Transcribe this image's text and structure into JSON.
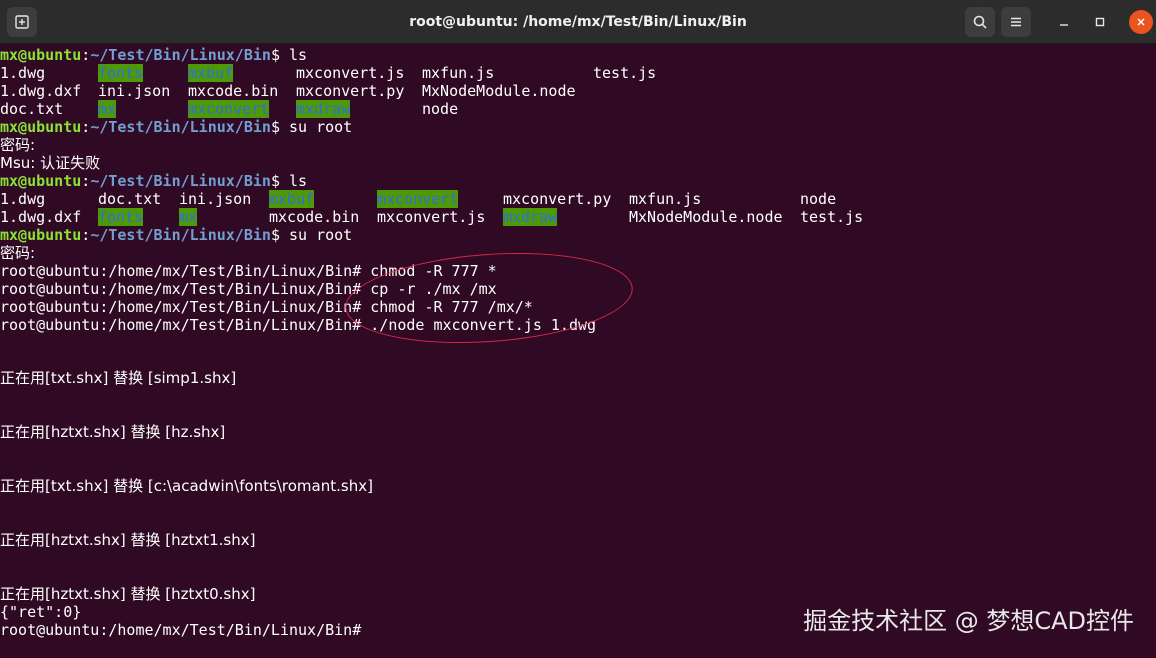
{
  "window": {
    "title": "root@ubuntu: /home/mx/Test/Bin/Linux/Bin",
    "new_tab_icon": "new-tab-icon",
    "search_icon": "search-icon",
    "menu_icon": "hamburger-menu-icon"
  },
  "prompt": {
    "user_host": "mx@ubuntu",
    "path": "~/Test/Bin/Linux/Bin",
    "root": "root@ubuntu:/home/mx/Test/Bin/Linux/Bin#"
  },
  "cmd": {
    "ls1": "ls",
    "su1": "su root",
    "ls2": "ls",
    "su2": "su root",
    "c1": "chmod -R 777 *",
    "c2": "cp -r ./mx /mx",
    "c3": "chmod -R 777 /mx/*",
    "c4": "./node mxconvert.js 1.dwg"
  },
  "ls1": [
    [
      "1.dwg",
      "fonts",
      "mxbuf",
      "mxconvert.js",
      "mxfun.js",
      "test.js"
    ],
    [
      "1.dwg.dxf",
      "ini.json",
      "mxcode.bin",
      "mxconvert.py",
      "MxNodeModule.node"
    ],
    [
      "doc.txt",
      "mx",
      "mxconvert",
      "mxdraw",
      "node"
    ]
  ],
  "ls2": [
    [
      "1.dwg",
      "doc.txt",
      "ini.json",
      "mxbuf",
      "mxconvert",
      "mxconvert.py",
      "mxfun.js",
      "node"
    ],
    [
      "1.dwg.dxf",
      "fonts",
      "mx",
      "mxcode.bin",
      "mxconvert.js",
      "mxdraw",
      "MxNodeModule.node",
      "test.js"
    ]
  ],
  "messages": {
    "password": "密码:",
    "su_fail": "Msu: 认证失败",
    "sub1": "正在用[txt.shx] 替换 [simp1.shx]",
    "sub2": "正在用[hztxt.shx] 替换 [hz.shx]",
    "sub3": "正在用[txt.shx] 替换 [c:\\acadwin\\fonts\\romant.shx]",
    "sub4": "正在用[hztxt.shx] 替换 [hztxt1.shx]",
    "sub5": "正在用[hztxt.shx] 替换 [hztxt0.shx]",
    "ret": "{\"ret\":0}"
  },
  "watermark": "掘金技术社区 @ 梦想CAD控件",
  "colors": {
    "terminal_bg": "#300a24",
    "prompt_user": "#8ae234",
    "prompt_path": "#729fcf",
    "dir_bg": "#4e9a06",
    "annotation": "#d8264b"
  }
}
